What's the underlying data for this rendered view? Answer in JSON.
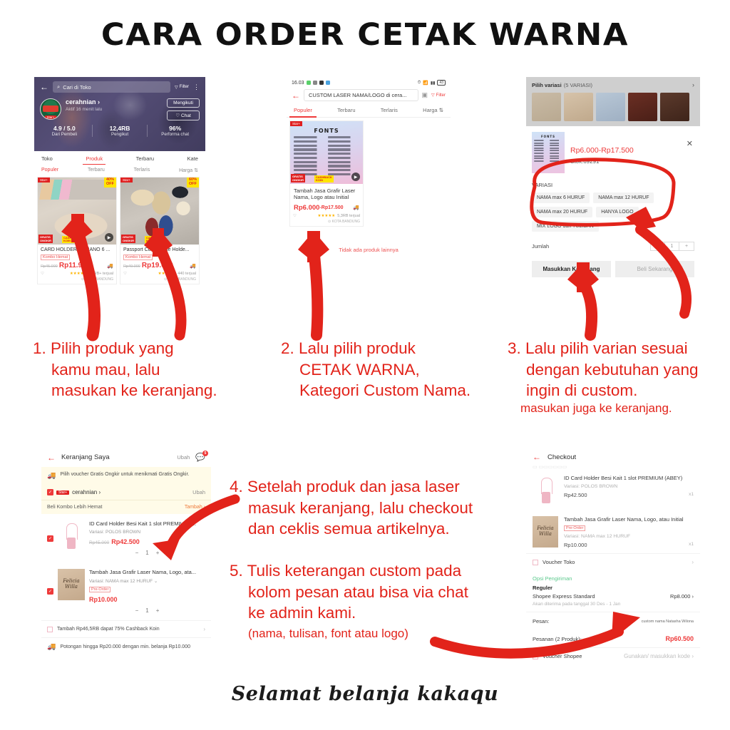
{
  "title": "CARA ORDER CETAK WARNA",
  "footer": "Selamat belanja kakaqu",
  "steps": {
    "step1": "1. Pilih produk yang\nkamu mau, lalu\nmasukan ke keranjang.",
    "step2": "2. Lalu pilih produk\nCETAK WARNA,\nKategori Custom Nama.",
    "step3": "3. Lalu pilih varian sesuai\ndengan kebutuhan yang\ningin di custom.",
    "step3_sub": "masukan juga ke keranjang.",
    "step4": "4. Setelah produk dan jasa laser\nmasuk keranjang, lalu checkout\ndan ceklis semua artikelnya.",
    "step5": "5. Tulis keterangan custom pada\nkolom pesan atau bisa via chat\nke admin kami.",
    "step5_sub": "(nama, tulisan, font atau logo)"
  },
  "shot1": {
    "search_placeholder": "Cari di Toko",
    "filter_label": "Filter",
    "store_name": "cerahnian",
    "store_status": "Aktif 16 menit lalu",
    "badge": "Star+",
    "follow_button": "Mengikuti",
    "chat_button": "Chat",
    "stats": [
      {
        "value": "4.9 / 5.0",
        "label": "Dari Pembeli"
      },
      {
        "value": "12,4RB",
        "label": "Pengikut"
      },
      {
        "value": "96%",
        "label": "Performa chat"
      }
    ],
    "tabs": [
      "Toko",
      "Produk",
      "Terbaru",
      "Kate"
    ],
    "active_tab": "Produk",
    "subtabs": [
      "Populer",
      "Terbaru",
      "Terlaris",
      "Harga"
    ],
    "active_subtab": "Populer",
    "products": [
      {
        "star_tag": "Star+",
        "discount": "40%\nOFF",
        "ship_tag": "GRATIS ONGKIR XTRA",
        "cash_tag": "CASHBACK KOIN",
        "title": "CARD HOLDER SAFIANO 6 ...",
        "kombo": "Kombo Hemat",
        "old_price": "Rp45.000",
        "price": "Rp11.900",
        "sold": "10RB+ terjual",
        "location": "KOTA BANDUNG"
      },
      {
        "star_tag": "Star+",
        "discount": "60%\nOFF",
        "ship_tag": "GRATIS ONGKIR XTRA",
        "cash_tag": "CASHBACK KOIN",
        "title": "Passport Cover Case Holde...",
        "kombo": "Kombo Hemat",
        "old_price": "Rp49.000",
        "price": "Rp19.600",
        "sold": "440 terjual",
        "location": "KOTA BANDUNG"
      }
    ]
  },
  "shot2": {
    "status_time": "16.03",
    "search_value": "CUSTOM LASER NAMA/LOGO di cera...",
    "filter_label": "Filter",
    "tabs": [
      "Populer",
      "Terbaru",
      "Terlaris",
      "Harga"
    ],
    "active_tab": "Populer",
    "card": {
      "star_tag": "Star+",
      "image_heading": "FONTS",
      "title": "Tambah Jasa Grafir Laser Nama, Logo atau Initial",
      "price": "Rp6.000",
      "price_range": "-Rp17.500",
      "sold": "5,3RB terjual",
      "location": "KOTA BANDUNG"
    },
    "empty_text": "Tidak ada produk lainnya"
  },
  "shot3": {
    "variation_header": "Pilih variasi",
    "variation_count": "(5 VARIASI)",
    "price": "Rp6.000-Rp17.500",
    "stock": "Stok:69291",
    "variation_label": "VARIASI",
    "variations": [
      "NAMA max 6 HURUF",
      "NAMA max 12 HURUF",
      "NAMA max 20 HURUF",
      "HANYA LOGO",
      "MIX LOGO dan TULISAN"
    ],
    "quantity_label": "Jumlah",
    "quantity_value": "1",
    "add_to_cart": "Masukkan Keranjang",
    "buy_now": "Beli Sekarang"
  },
  "shot4": {
    "title": "Keranjang Saya",
    "edit": "Ubah",
    "chat_count": "5",
    "voucher_text": "Pilih voucher Gratis Ongkir untuk menikmati Gratis Ongkir.",
    "store_badge": "Star+",
    "store_name": "cerahnian",
    "store_edit": "Ubah",
    "kombo_text": "Beli Kombo Lebih Hemat",
    "kombo_action": "Tambah",
    "items": [
      {
        "name": "ID Card Holder Besi Kait 1 slot PREMIUM (...",
        "variant": "Variasi: POLOS BROWN",
        "old_price": "Rp45.000",
        "price": "Rp42.500",
        "qty": "1"
      },
      {
        "name": "Tambah Jasa Grafir Laser Nama, Logo, ata...",
        "variant": "Variasi: NAMA max 12 HURUF",
        "badge": "Pre-Order",
        "price": "Rp10.000",
        "qty": "1"
      }
    ],
    "promo1": "Tambah Rp46,5RB dapat 75% Cashback Koin",
    "promo2": "Potongan hingga Rp20.000 dengan min. belanja Rp10.000"
  },
  "shot5": {
    "title": "Checkout",
    "items": [
      {
        "name": "ID Card Holder Besi Kait 1 slot PREMIUM (ABEY)",
        "variant": "Variasi: POLOS BROWN",
        "price": "Rp42.500",
        "qty": "x1"
      },
      {
        "name": "Tambah Jasa Grafir Laser Nama, Logo, atau Initial",
        "badge": "Pre-Order",
        "variant": "Variasi: NAMA max 12 HURUF",
        "price": "Rp10.000",
        "qty": "x1"
      }
    ],
    "voucher_toko": "Voucher Toko",
    "shipping_label": "Opsi Pengiriman",
    "shipping_type": "Reguler",
    "shipping_name": "Shopee Express Standard",
    "shipping_price": "Rp8.000",
    "shipping_note": "Akan diterima pada tanggal 30 Des - 1 Jan",
    "message_label": "Pesan:",
    "message_value": "custom nama Natasha Wilona",
    "total_label": "Pesanan (2 Produk):",
    "total_value": "Rp60.500",
    "voucher_shopee": "Voucher Shopee",
    "voucher_shopee_action": "Gunakan/ masukkan kode"
  },
  "colors": {
    "accent_red": "#e2231a",
    "shopee_red": "#ee3a3a",
    "green": "#2fbf6b",
    "yellow": "#ffe500"
  }
}
